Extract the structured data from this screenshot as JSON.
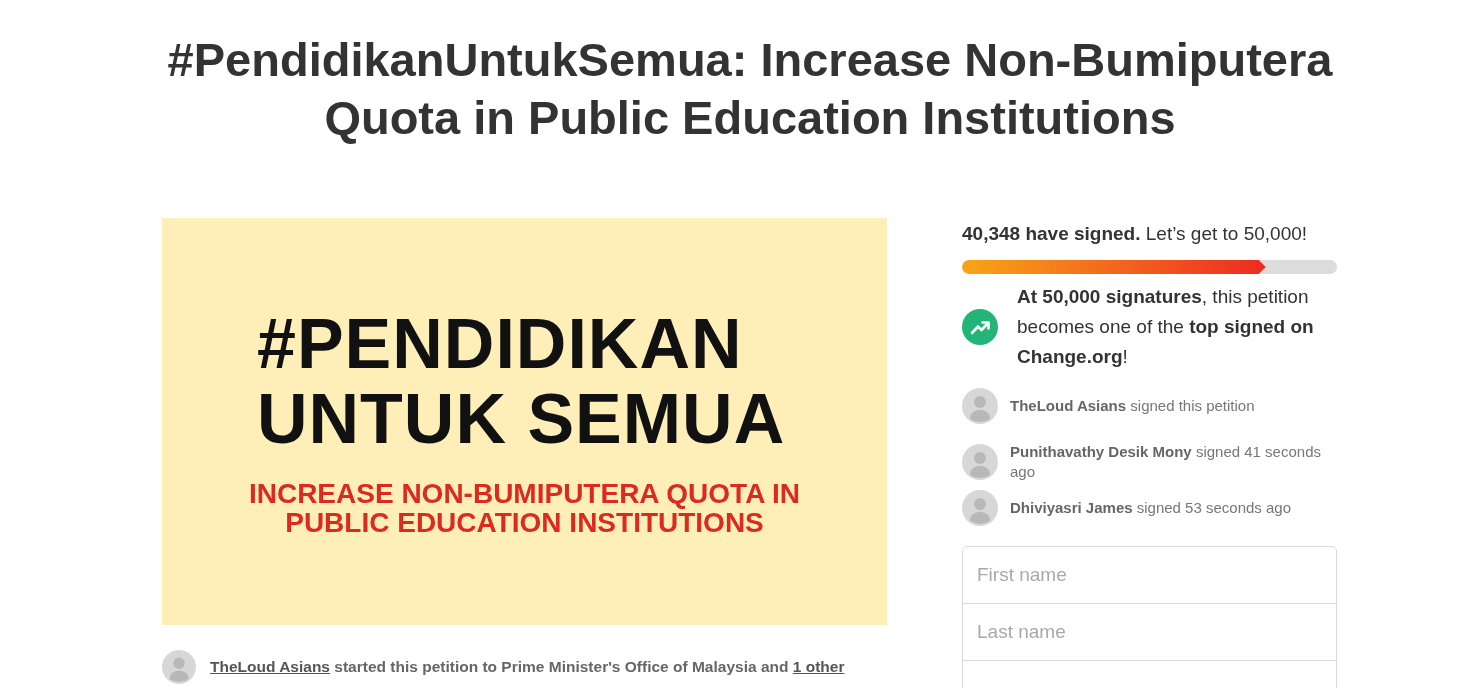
{
  "title": "#PendidikanUntukSemua: Increase Non-Bumiputera Quota in Public Education Institutions",
  "banner": {
    "headline": "#PENDIDIKAN UNTUK SEMUA",
    "subline": "INCREASE NON-BUMIPUTERA QUOTA IN PUBLIC EDUCATION INSTITUTIONS"
  },
  "starter": {
    "name": "TheLoud Asians",
    "text": "started this petition to Prime Minister's Office of Malaysia and",
    "others_link": "1 other"
  },
  "progress": {
    "text": "**40,348 have signed.** Let’s get to 50,000!",
    "level": 0.81
  },
  "milestone": {
    "text": "**At 50,000 signatures**, this petition becomes one of the **top signed on Change.org**!"
  },
  "signers": [
    {
      "text": "**TheLoud Asians** signed this petition"
    },
    {
      "text": "**Punithavathy Desik Mony** signed 41 seconds ago"
    },
    {
      "text": "**Dhiviyasri James** signed 53 seconds ago"
    }
  ],
  "form": {
    "fields": [
      {
        "placeholder": "First name"
      },
      {
        "placeholder": "Last name"
      }
    ],
    "cut_off_field_below": true
  }
}
